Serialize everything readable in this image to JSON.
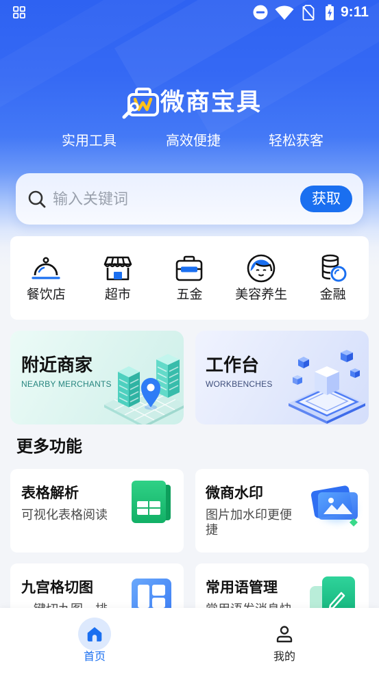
{
  "status_bar": {
    "time": "9:11",
    "left_icons": [
      "apps-grid-icon"
    ],
    "right_icons": [
      "do-not-disturb-icon",
      "wifi-icon",
      "no-sim-icon",
      "battery-charging-icon"
    ]
  },
  "header": {
    "logo_icon": "briefcase-wrench-logo",
    "app_name": "微商宝具",
    "taglines": [
      "实用工具",
      "高效便捷",
      "轻松获客"
    ]
  },
  "search": {
    "icon": "search-icon",
    "placeholder": "输入关键词",
    "value": "",
    "button_label": "获取"
  },
  "categories": [
    {
      "label": "餐饮店",
      "icon": "cloche-icon"
    },
    {
      "label": "超市",
      "icon": "store-icon"
    },
    {
      "label": "五金",
      "icon": "toolbox-icon"
    },
    {
      "label": "美容养生",
      "icon": "beauty-face-icon"
    },
    {
      "label": "金融",
      "icon": "coins-icon"
    }
  ],
  "feature_cards": [
    {
      "title": "附近商家",
      "subtitle": "NEARBY MERCHANTS",
      "illustration": "city-map-pin-illustration"
    },
    {
      "title": "工作台",
      "subtitle": "WORKBENCHES",
      "illustration": "isometric-cubes-illustration"
    }
  ],
  "more_functions": {
    "title": "更多功能",
    "items": [
      {
        "title": "表格解析",
        "subtitle": "可视化表格阅读",
        "icon": "spreadsheet-icon"
      },
      {
        "title": "微商水印",
        "subtitle": "图片加水印更便捷",
        "icon": "image-watermark-icon"
      },
      {
        "title": "九宫格切图",
        "subtitle": "一键切九图，排",
        "icon": "grid-cut-icon"
      },
      {
        "title": "常用语管理",
        "subtitle": "常用语发消息快",
        "icon": "note-edit-icon"
      }
    ]
  },
  "bottom_nav": {
    "items": [
      {
        "label": "首页",
        "icon": "home-icon",
        "active": true
      },
      {
        "label": "我的",
        "icon": "person-icon",
        "active": false
      }
    ]
  },
  "theme": {
    "primary": "#1a6ff0",
    "hero_blue": "#2e62f2",
    "page_background": "#f3f5f9",
    "logo_accent": "#ffc21a",
    "spreadsheet_green": "#12b066",
    "note_green": "#13b37b"
  }
}
